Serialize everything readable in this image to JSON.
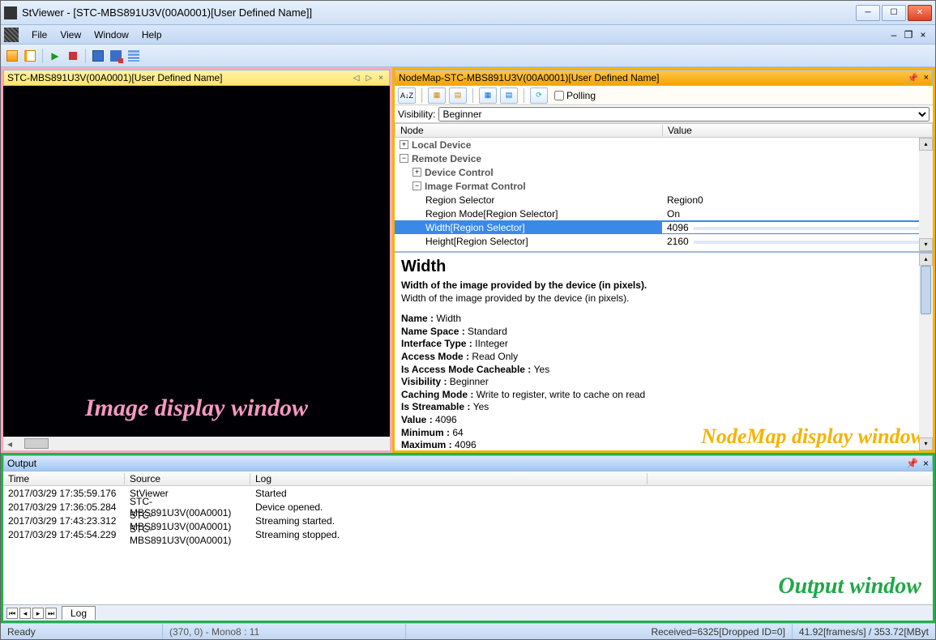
{
  "window": {
    "title": "StViewer - [STC-MBS891U3V(00A0001)[User Defined Name]]"
  },
  "menu": {
    "items": [
      "File",
      "View",
      "Window",
      "Help"
    ]
  },
  "image_panel": {
    "tab_title": "STC-MBS891U3V(00A0001)[User Defined Name]",
    "overlay": "Image display window"
  },
  "nodemap": {
    "title": "NodeMap-STC-MBS891U3V(00A0001)[User Defined Name]",
    "polling_label": "Polling",
    "visibility_label": "Visibility:",
    "visibility_value": "Beginner",
    "columns": {
      "node": "Node",
      "value": "Value"
    },
    "rows": [
      {
        "kind": "group",
        "indent": 0,
        "exp": "+",
        "label": "Local Device",
        "value": ""
      },
      {
        "kind": "group",
        "indent": 0,
        "exp": "−",
        "label": "Remote Device",
        "value": ""
      },
      {
        "kind": "group",
        "indent": 1,
        "exp": "+",
        "label": "Device Control",
        "value": ""
      },
      {
        "kind": "group",
        "indent": 1,
        "exp": "−",
        "label": "Image Format Control",
        "value": ""
      },
      {
        "kind": "leaf",
        "indent": 2,
        "label": "Region Selector",
        "value": "Region0"
      },
      {
        "kind": "leaf",
        "indent": 2,
        "label": "Region Mode[Region Selector]",
        "value": "On"
      },
      {
        "kind": "sel",
        "indent": 2,
        "label": "Width[Region Selector]",
        "value": "4096"
      },
      {
        "kind": "leaf",
        "indent": 2,
        "label": "Height[Region Selector]",
        "value": "2160"
      }
    ],
    "desc": {
      "title": "Width",
      "summary": "Width of the image provided by the device (in pixels).",
      "detail": "Width of the image provided by the device (in pixels).",
      "props": [
        [
          "Name :",
          "Width"
        ],
        [
          "Name Space :",
          "Standard"
        ],
        [
          "Interface Type :",
          "IInteger"
        ],
        [
          "Access Mode :",
          "Read Only"
        ],
        [
          "Is Access Mode Cacheable :",
          "Yes"
        ],
        [
          "Visibility :",
          "Beginner"
        ],
        [
          "Caching Mode :",
          "Write to register, write to cache on read"
        ],
        [
          "Is Streamable :",
          "Yes"
        ],
        [
          "Value :",
          "4096"
        ],
        [
          "Minimum :",
          "64"
        ],
        [
          "Maximum :",
          "4096"
        ]
      ],
      "overlay": "NodeMap display window"
    }
  },
  "output": {
    "title": "Output",
    "columns": {
      "time": "Time",
      "source": "Source",
      "log": "Log"
    },
    "rows": [
      {
        "time": "2017/03/29 17:35:59.176",
        "source": "StViewer",
        "log": "Started"
      },
      {
        "time": "2017/03/29 17:36:05.284",
        "source": "STC-MBS891U3V(00A0001)",
        "log": "Device opened."
      },
      {
        "time": "2017/03/29 17:43:23.312",
        "source": "STC-MBS891U3V(00A0001)",
        "log": "Streaming started."
      },
      {
        "time": "2017/03/29 17:45:54.229",
        "source": "STC-MBS891U3V(00A0001)",
        "log": "Streaming stopped."
      }
    ],
    "tab": "Log",
    "overlay": "Output window"
  },
  "status": {
    "ready": "Ready",
    "cursor": "(370, 0) - Mono8 : 11",
    "received": "Received=6325[Dropped ID=0]",
    "rate": "41.92[frames/s] / 353.72[MByt"
  }
}
